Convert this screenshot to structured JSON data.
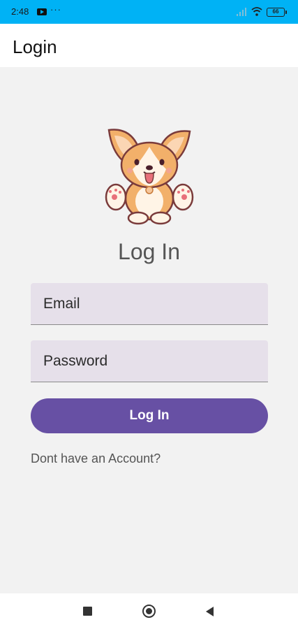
{
  "status_bar": {
    "time": "2:48",
    "dots": "···",
    "battery": "66"
  },
  "app_bar": {
    "title": "Login"
  },
  "login": {
    "heading": "Log In",
    "email_placeholder": "Email",
    "password_placeholder": "Password",
    "button_label": "Log In",
    "account_link": "Dont have an Account?"
  },
  "colors": {
    "status_bar": "#00b2f5",
    "accent": "#6750a4",
    "field_bg": "#e6e0ea"
  },
  "icons": {
    "logo": "corgi-logo-icon"
  }
}
